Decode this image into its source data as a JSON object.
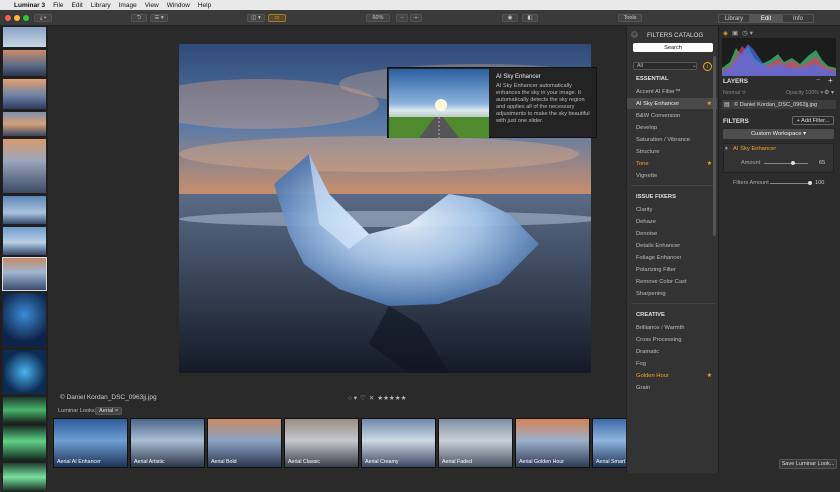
{
  "menubar": {
    "app_name": "Luminar 3",
    "items": [
      "File",
      "Edit",
      "Library",
      "Image",
      "View",
      "Window",
      "Help"
    ]
  },
  "toolbar": {
    "zoom": "60%",
    "zoom_out": "−",
    "zoom_in": "+",
    "tools_label": "Tools",
    "tabs": [
      "Library",
      "Edit",
      "Info"
    ],
    "active_tab": "Edit"
  },
  "tooltip": {
    "title": "AI Sky Enhancer",
    "description": "AI Sky Enhancer automatically enhances the sky in your image. It automatically detects the sky region and applies all of the necessary adjustments to make the sky beautiful with just one slider."
  },
  "canvas": {
    "caption": "© Daniel Kordan_DSC_0963jj.jpg",
    "rating_stars": "★★★★★",
    "reject": "✕"
  },
  "looks": {
    "label": "Luminar Looks:",
    "category": "Aerial",
    "items": [
      "Aerial AI Enhancer",
      "Aerial Artistic",
      "Aerial Bold",
      "Aerial Classic",
      "Aerial Creamy",
      "Aerial Faded",
      "Aerial Golden Hour",
      "Aerial Smart Dehaze"
    ]
  },
  "catalog": {
    "title": "FILTERS CATALOG",
    "search": "Search",
    "filter_select": "All",
    "sections": [
      {
        "heading": "ESSENTIAL",
        "items": [
          {
            "label": "Accent AI Filter™",
            "sel": false,
            "fav": false
          },
          {
            "label": "AI Sky Enhancer",
            "sel": true,
            "fav": true
          },
          {
            "label": "B&W Conversion",
            "sel": false,
            "fav": false
          },
          {
            "label": "Develop",
            "sel": false,
            "fav": false
          },
          {
            "label": "Saturation / Vibrance",
            "sel": false,
            "fav": false
          },
          {
            "label": "Structure",
            "sel": false,
            "fav": false
          },
          {
            "label": "Tone",
            "sel": false,
            "fav": true
          },
          {
            "label": "Vignette",
            "sel": false,
            "fav": false
          }
        ]
      },
      {
        "heading": "ISSUE FIXERS",
        "items": [
          {
            "label": "Clarity",
            "sel": false,
            "fav": false
          },
          {
            "label": "Dehaze",
            "sel": false,
            "fav": false
          },
          {
            "label": "Denoise",
            "sel": false,
            "fav": false
          },
          {
            "label": "Details Enhancer",
            "sel": false,
            "fav": false
          },
          {
            "label": "Foliage Enhancer",
            "sel": false,
            "fav": false
          },
          {
            "label": "Polarizing Filter",
            "sel": false,
            "fav": false
          },
          {
            "label": "Remove Color Cast",
            "sel": false,
            "fav": false
          },
          {
            "label": "Sharpening",
            "sel": false,
            "fav": false
          }
        ]
      },
      {
        "heading": "CREATIVE",
        "items": [
          {
            "label": "Brilliance / Warmth",
            "sel": false,
            "fav": false
          },
          {
            "label": "Cross Processing",
            "sel": false,
            "fav": false
          },
          {
            "label": "Dramatic",
            "sel": false,
            "fav": false
          },
          {
            "label": "Fog",
            "sel": false,
            "fav": false
          },
          {
            "label": "Golden Hour",
            "sel": false,
            "fav": true
          },
          {
            "label": "Grain",
            "sel": false,
            "fav": false
          }
        ]
      }
    ]
  },
  "panel": {
    "layers_title": "LAYERS",
    "blend_mode": "Normal ≎",
    "opacity": "Opacity 100% ▾",
    "layer_name": "© Daniel Kordan_DSC_0963jj.jpg",
    "filters_title": "FILTERS",
    "add_filter": "+ Add Filter...",
    "workspace": "Custom Workspace ▾",
    "filter_name": "AI Sky Enhancer",
    "amount_label": "Amount",
    "amount_value": "65",
    "amount_level": 0.65,
    "filters_amount_label": "Filters Amount",
    "filters_amount_value": "100",
    "filters_amount_level": 1.0,
    "save_look": "Save Luminar Look..."
  }
}
